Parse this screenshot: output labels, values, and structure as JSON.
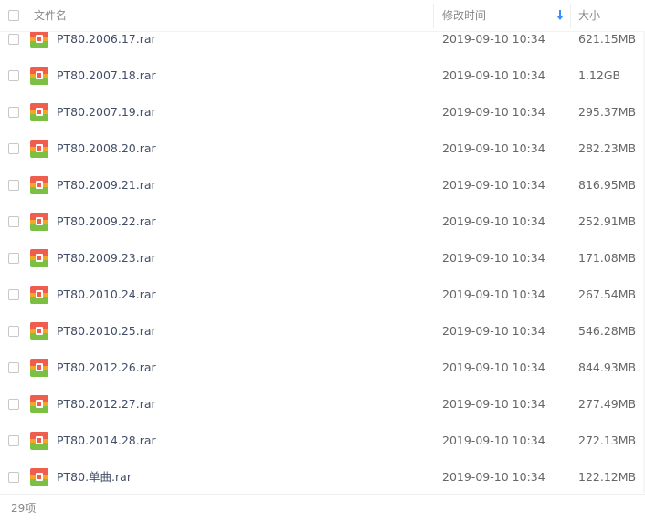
{
  "header": {
    "name_label": "文件名",
    "modified_label": "修改时间",
    "size_label": "大小"
  },
  "files": [
    {
      "name": "PT80.2006.17.rar",
      "modified": "2019-09-10 10:34",
      "size": "621.15MB"
    },
    {
      "name": "PT80.2007.18.rar",
      "modified": "2019-09-10 10:34",
      "size": "1.12GB"
    },
    {
      "name": "PT80.2007.19.rar",
      "modified": "2019-09-10 10:34",
      "size": "295.37MB"
    },
    {
      "name": "PT80.2008.20.rar",
      "modified": "2019-09-10 10:34",
      "size": "282.23MB"
    },
    {
      "name": "PT80.2009.21.rar",
      "modified": "2019-09-10 10:34",
      "size": "816.95MB"
    },
    {
      "name": "PT80.2009.22.rar",
      "modified": "2019-09-10 10:34",
      "size": "252.91MB"
    },
    {
      "name": "PT80.2009.23.rar",
      "modified": "2019-09-10 10:34",
      "size": "171.08MB"
    },
    {
      "name": "PT80.2010.24.rar",
      "modified": "2019-09-10 10:34",
      "size": "267.54MB"
    },
    {
      "name": "PT80.2010.25.rar",
      "modified": "2019-09-10 10:34",
      "size": "546.28MB"
    },
    {
      "name": "PT80.2012.26.rar",
      "modified": "2019-09-10 10:34",
      "size": "844.93MB"
    },
    {
      "name": "PT80.2012.27.rar",
      "modified": "2019-09-10 10:34",
      "size": "277.49MB"
    },
    {
      "name": "PT80.2014.28.rar",
      "modified": "2019-09-10 10:34",
      "size": "272.13MB"
    },
    {
      "name": "PT80.单曲.rar",
      "modified": "2019-09-10 10:34",
      "size": "122.12MB"
    }
  ],
  "footer": {
    "count_label": "29项"
  },
  "icons": {
    "sort": "arrow-down-icon",
    "file": "rar-archive-icon"
  },
  "colors": {
    "sort_arrow": "#3b8cff",
    "archive_top": "#ef5d4e",
    "archive_bottom": "#7bc043",
    "archive_band": "#f5a623"
  }
}
